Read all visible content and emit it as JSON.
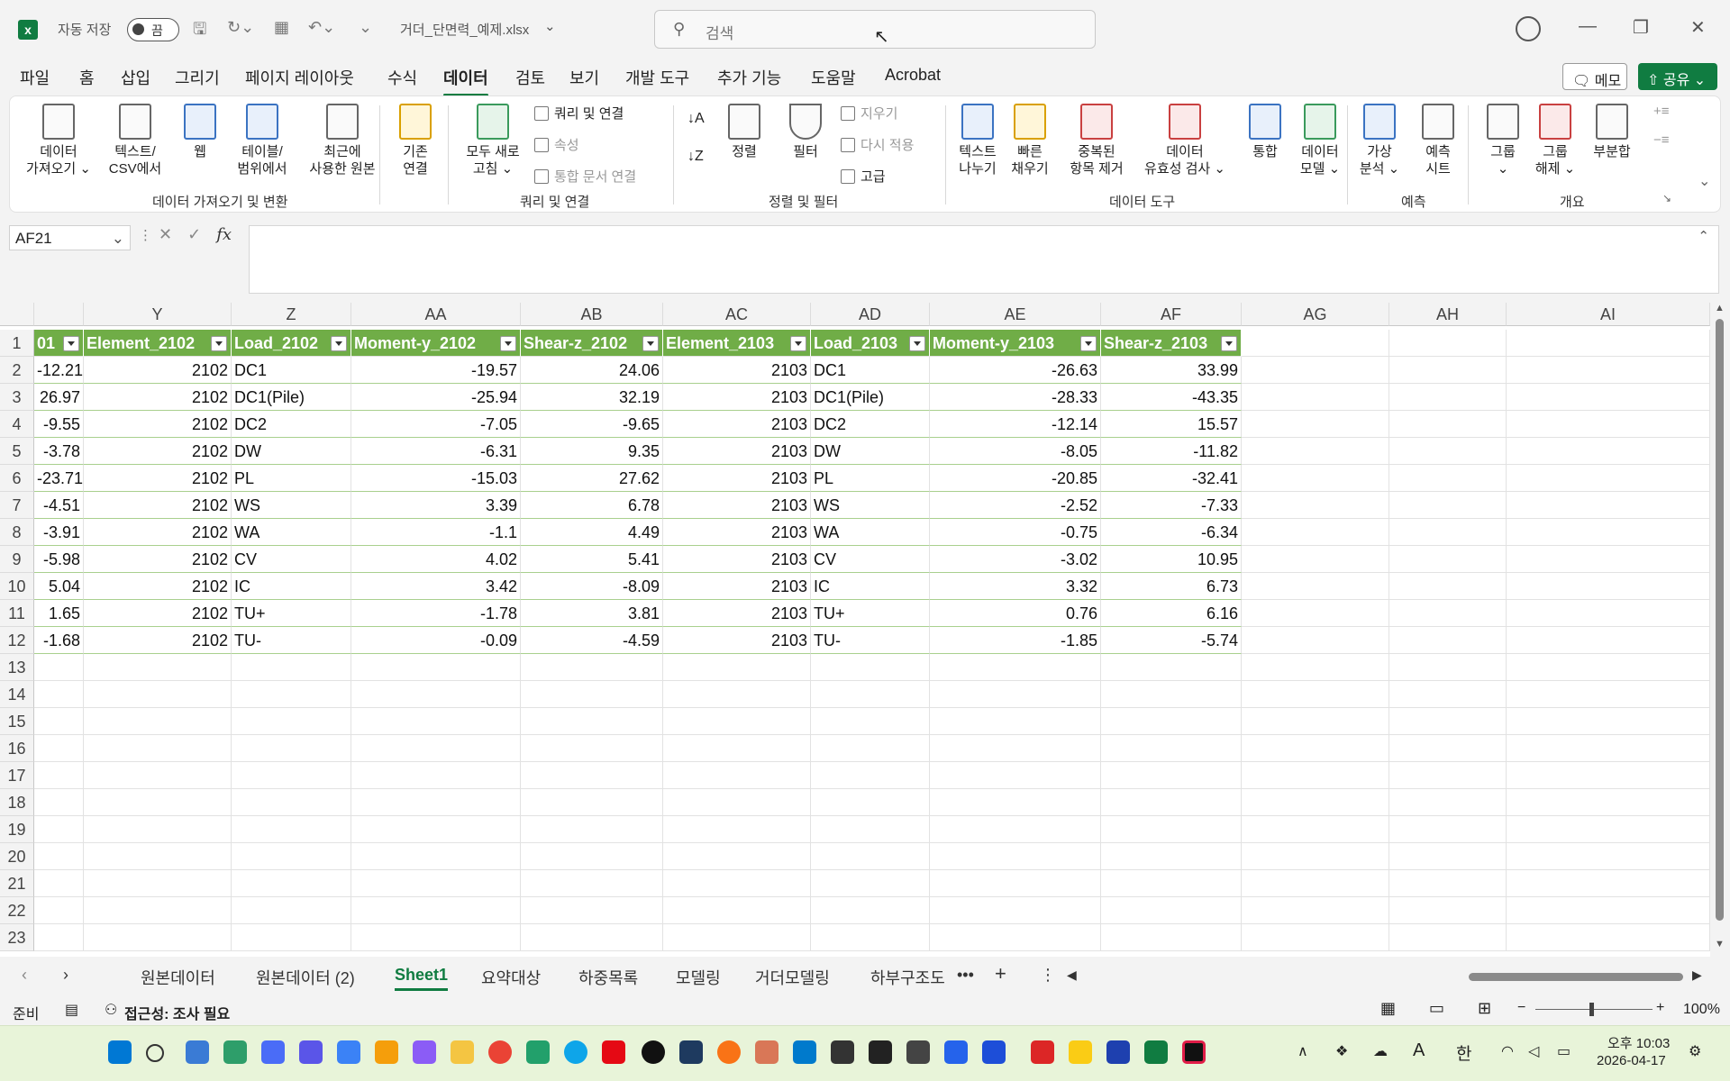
{
  "titlebar": {
    "autosave_label": "자동 저장",
    "autosave_state": "끔",
    "filename": "거더_단면력_예제.xlsx",
    "search_placeholder": "검색"
  },
  "menu": {
    "tabs": [
      "파일",
      "홈",
      "삽입",
      "그리기",
      "페이지 레이아웃",
      "수식",
      "데이터",
      "검토",
      "보기",
      "개발 도구",
      "추가 기능",
      "도움말",
      "Acrobat"
    ],
    "active": "데이터",
    "memo": "메모",
    "share": "공유"
  },
  "ribbon": {
    "get_data": [
      "데이터",
      "가져오기"
    ],
    "text_csv": [
      "텍스트/",
      "CSV에서"
    ],
    "web": "웹",
    "table_range": [
      "테이블/",
      "범위에서"
    ],
    "recent_sources": [
      "최근에",
      "사용한 원본"
    ],
    "existing_conn": [
      "기존",
      "연결"
    ],
    "group1": "데이터 가져오기 및 변환",
    "refresh_all": [
      "모두 새로",
      "고침"
    ],
    "queries_conn": "쿼리 및 연결",
    "properties": "속성",
    "edit_links": "통합 문서 연결",
    "group2": "쿼리 및 연결",
    "sort": "정렬",
    "filter": "필터",
    "clear": "지우기",
    "reapply": "다시 적용",
    "advanced": "고급",
    "group3": "정렬 및 필터",
    "text_to_columns": [
      "텍스트",
      "나누기"
    ],
    "flash_fill": [
      "빠른",
      "채우기"
    ],
    "remove_dup": [
      "중복된",
      "항목 제거"
    ],
    "validation": [
      "데이터",
      "유효성 검사"
    ],
    "consolidate": "통합",
    "data_model": [
      "데이터",
      "모델"
    ],
    "group4": "데이터 도구",
    "what_if": [
      "가상",
      "분석"
    ],
    "forecast": [
      "예측",
      "시트"
    ],
    "group5": "예측",
    "group_btn": "그룹",
    "ungroup": [
      "그룹",
      "해제"
    ],
    "subtotal": "부분합",
    "group6": "개요"
  },
  "formula_bar": {
    "name_box": "AF21",
    "fx": "fx",
    "content": ""
  },
  "sheet": {
    "columns": [
      "Y",
      "Z",
      "AA",
      "AB",
      "AC",
      "AD",
      "AE",
      "AF",
      "AG",
      "AH",
      "AI"
    ],
    "header_row": [
      "01",
      "Element_2102",
      "Load_2102",
      "Moment-y_2102",
      "Shear-z_2102",
      "Element_2103",
      "Load_2103",
      "Moment-y_2103",
      "Shear-z_2103"
    ],
    "rows": [
      [
        "-12.21",
        "2102",
        "DC1",
        "-19.57",
        "24.06",
        "2103",
        "DC1",
        "-26.63",
        "33.99"
      ],
      [
        "26.97",
        "2102",
        "DC1(Pile)",
        "-25.94",
        "32.19",
        "2103",
        "DC1(Pile)",
        "-28.33",
        "-43.35"
      ],
      [
        "-9.55",
        "2102",
        "DC2",
        "-7.05",
        "-9.65",
        "2103",
        "DC2",
        "-12.14",
        "15.57"
      ],
      [
        "-3.78",
        "2102",
        "DW",
        "-6.31",
        "9.35",
        "2103",
        "DW",
        "-8.05",
        "-11.82"
      ],
      [
        "-23.71",
        "2102",
        "PL",
        "-15.03",
        "27.62",
        "2103",
        "PL",
        "-20.85",
        "-32.41"
      ],
      [
        "-4.51",
        "2102",
        "WS",
        "3.39",
        "6.78",
        "2103",
        "WS",
        "-2.52",
        "-7.33"
      ],
      [
        "-3.91",
        "2102",
        "WA",
        "-1.1",
        "4.49",
        "2103",
        "WA",
        "-0.75",
        "-6.34"
      ],
      [
        "-5.98",
        "2102",
        "CV",
        "4.02",
        "5.41",
        "2103",
        "CV",
        "-3.02",
        "10.95"
      ],
      [
        "5.04",
        "2102",
        "IC",
        "3.42",
        "-8.09",
        "2103",
        "IC",
        "3.32",
        "6.73"
      ],
      [
        "1.65",
        "2102",
        "TU+",
        "-1.78",
        "3.81",
        "2103",
        "TU+",
        "0.76",
        "6.16"
      ],
      [
        "-1.68",
        "2102",
        "TU-",
        "-0.09",
        "-4.59",
        "2103",
        "TU-",
        "-1.85",
        "-5.74"
      ]
    ],
    "row_numbers": [
      "1",
      "2",
      "3",
      "4",
      "5",
      "6",
      "7",
      "8",
      "9",
      "10",
      "11",
      "12",
      "13",
      "14",
      "15",
      "16",
      "17",
      "18",
      "19",
      "20",
      "21",
      "22",
      "23"
    ]
  },
  "sheet_tabs": {
    "tabs": [
      "원본데이터",
      "원본데이터 (2)",
      "Sheet1",
      "요약대상",
      "하중목록",
      "모델링",
      "거더모델링",
      "하부구조도"
    ],
    "active": "Sheet1"
  },
  "status": {
    "ready": "준비",
    "accessibility": "접근성: 조사 필요",
    "zoom": "100%"
  },
  "taskbar": {
    "ampm_time": "오후 10:03",
    "date": "2026-04-17",
    "ime": "한",
    "font_a": "A"
  },
  "colors": {
    "excel_green": "#107c41",
    "table_header": "#70ad47",
    "taskbar": "#e8f4d9"
  }
}
